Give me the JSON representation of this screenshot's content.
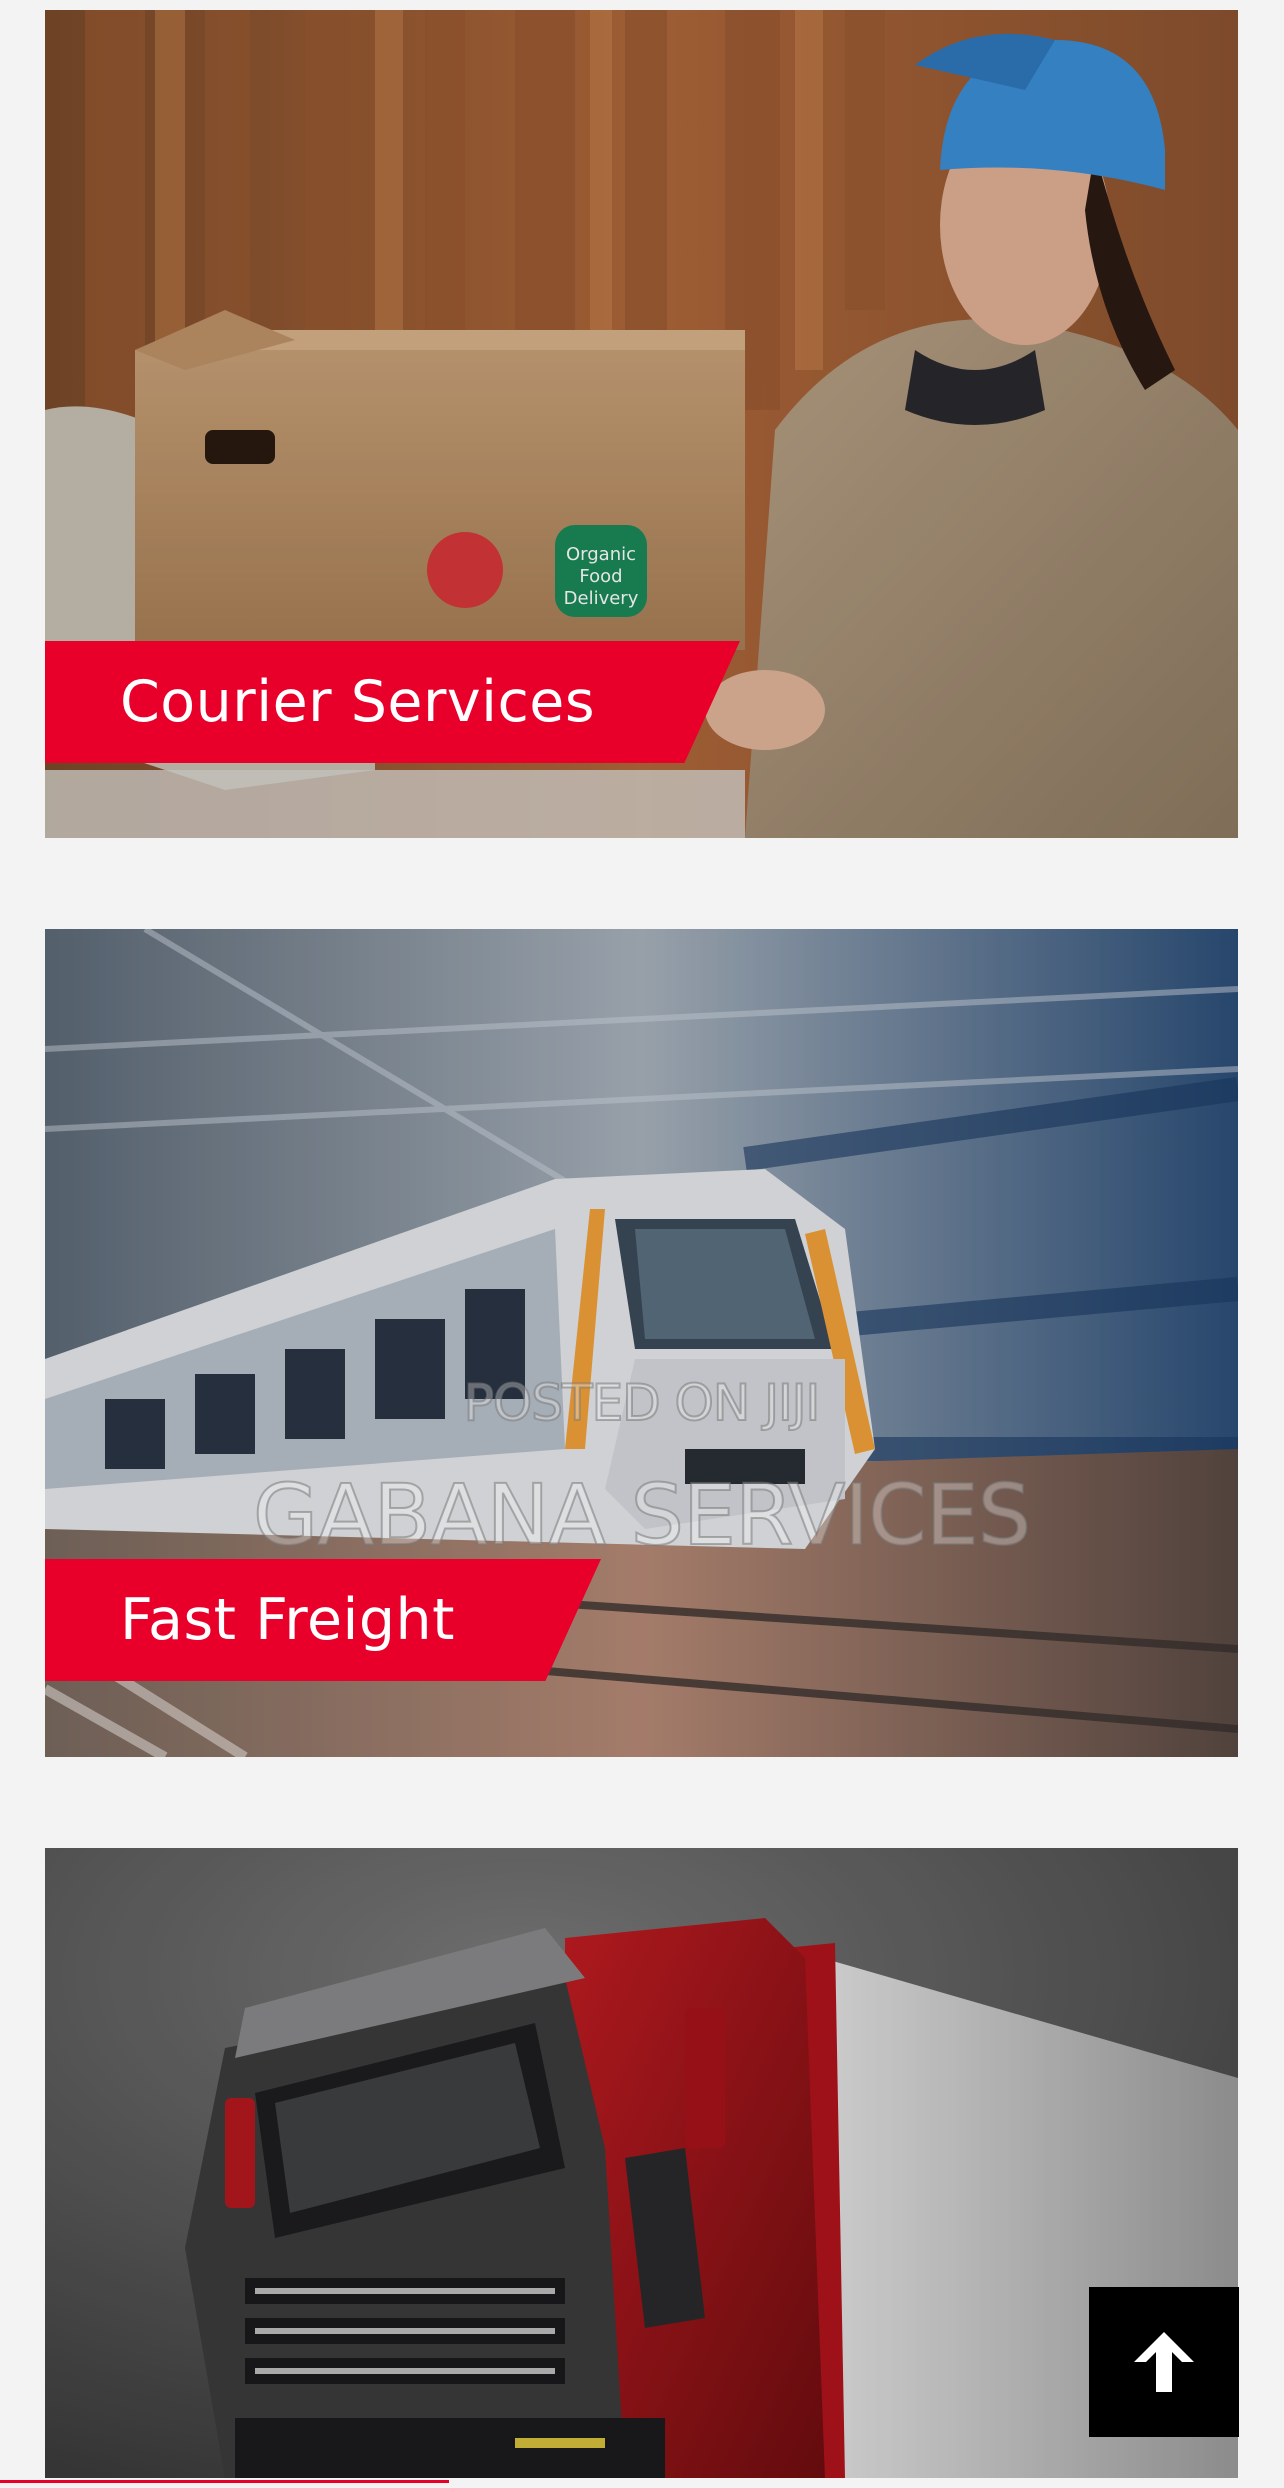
{
  "cards": [
    {
      "label": "Courier Services"
    },
    {
      "label": "Fast Freight"
    },
    {
      "label": ""
    }
  ],
  "watermark": {
    "line1": "POSTED ON JIJI",
    "line2": "GABANA SERVICES"
  },
  "icons": {
    "scroll_top": "arrow-up-icon"
  },
  "colors": {
    "accent": "#e8002b",
    "background": "#f4f3f4",
    "scroll_top_bg": "#000000"
  },
  "scroll_progress": 0.35
}
